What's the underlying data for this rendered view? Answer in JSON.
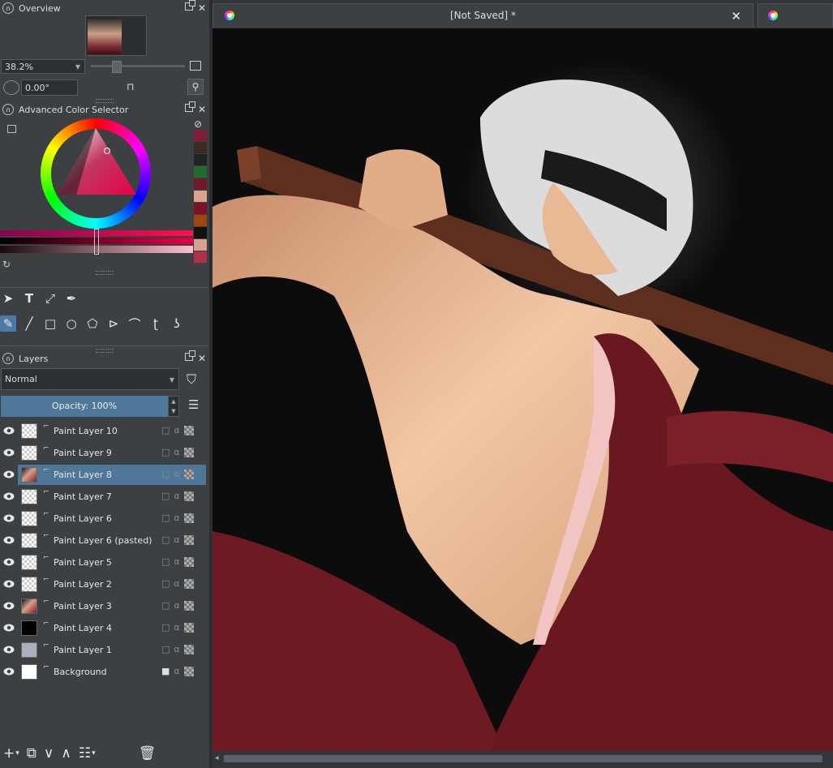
{
  "overview": {
    "title": "Overview",
    "zoom": "38.2%",
    "angle": "0.00°"
  },
  "color_selector": {
    "title": "Advanced Color Selector",
    "history": [
      "#7d1f35",
      "#3d2a22",
      "#222222",
      "#1f6b2a",
      "#6e1a2b",
      "#d9a48a",
      "#7b1228",
      "#a04410",
      "#111111",
      "#d8a08f",
      "#b03048"
    ]
  },
  "layers": {
    "title": "Layers",
    "blend_mode": "Normal",
    "opacity_label": "Opacity:  100%",
    "items": [
      {
        "name": "Paint Layer 10",
        "thumb": "check",
        "selected": false,
        "locked": false
      },
      {
        "name": "Paint Layer 9",
        "thumb": "check",
        "selected": false,
        "locked": false
      },
      {
        "name": "Paint Layer 8",
        "thumb": "art",
        "selected": true,
        "locked": false
      },
      {
        "name": "Paint Layer 7",
        "thumb": "check",
        "selected": false,
        "locked": false
      },
      {
        "name": "Paint Layer 6",
        "thumb": "check",
        "selected": false,
        "locked": false
      },
      {
        "name": "Paint Layer 6 (pasted)",
        "thumb": "check",
        "selected": false,
        "locked": false
      },
      {
        "name": "Paint Layer 5",
        "thumb": "check",
        "selected": false,
        "locked": false
      },
      {
        "name": "Paint Layer 2",
        "thumb": "check",
        "selected": false,
        "locked": false
      },
      {
        "name": "Paint Layer 3",
        "thumb": "art",
        "selected": false,
        "locked": false
      },
      {
        "name": "Paint Layer 4",
        "thumb": "black",
        "selected": false,
        "locked": false
      },
      {
        "name": "Paint Layer 1",
        "thumb": "gray",
        "selected": false,
        "locked": false
      },
      {
        "name": "Background",
        "thumb": "white",
        "selected": false,
        "locked": true
      }
    ]
  },
  "document": {
    "tab_title": "[Not Saved]  *",
    "close": "✕"
  },
  "colors": {
    "selection": "#4f7799",
    "panel": "#3c4043",
    "canvas_bg": "#0c0c0c",
    "robe": "#6e1a22",
    "skin": "#e8b892"
  }
}
